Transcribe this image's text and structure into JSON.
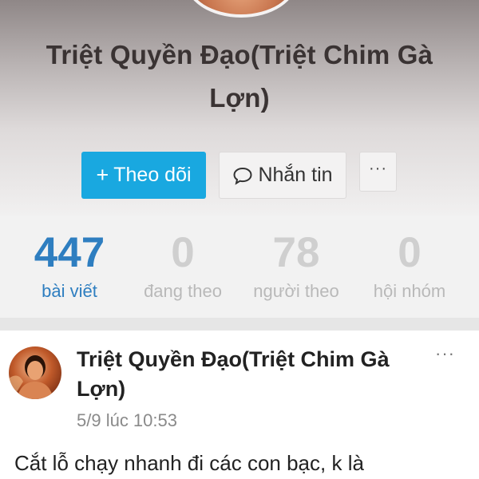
{
  "profile": {
    "name": "Triệt Quyền Đạo(Triệt Chim Gà Lợn)"
  },
  "actions": {
    "follow_label": "Theo dõi",
    "follow_icon": "+",
    "message_label": "Nhắn tin",
    "more_icon": "···"
  },
  "stats": [
    {
      "value": "447",
      "label": "bài viết"
    },
    {
      "value": "0",
      "label": "đang theo"
    },
    {
      "value": "78",
      "label": "người theo"
    },
    {
      "value": "0",
      "label": "hội nhóm"
    }
  ],
  "post": {
    "author": "Triệt Quyền Đạo(Triệt Chim Gà Lợn)",
    "time": "5/9 lúc 10:53",
    "more_icon": "···",
    "text": "Cắt lỗ chạy nhanh đi các con bạc, k là"
  },
  "colors": {
    "accent": "#19a8e0",
    "stat_active": "#2e7ec0",
    "stat_inactive": "#cfcfcf"
  }
}
